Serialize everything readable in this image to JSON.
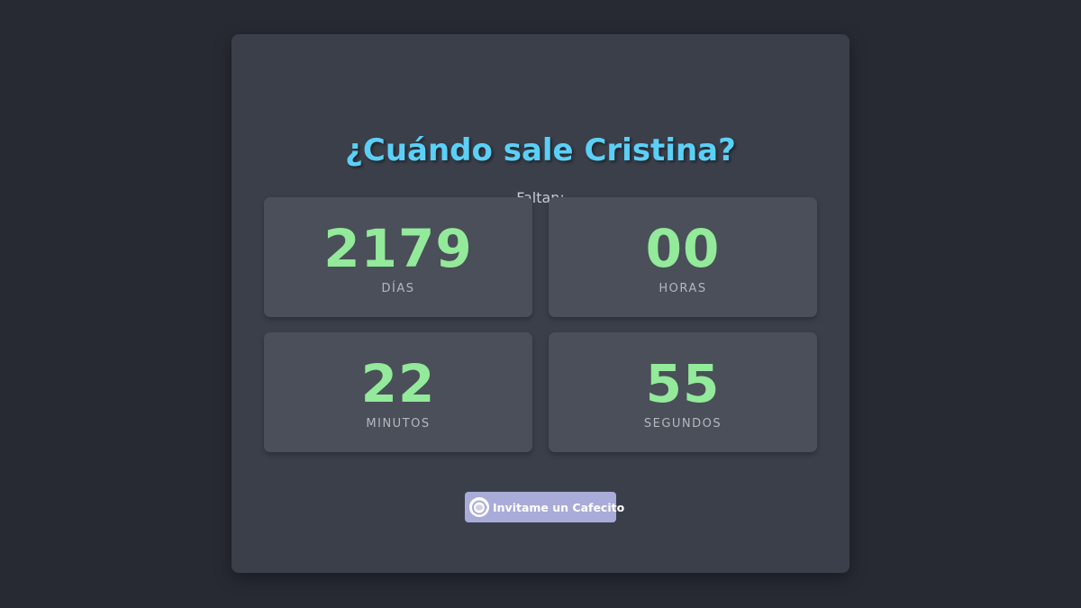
{
  "header": {
    "title": "¿Cuándo sale Cristina?",
    "subtitle": "Faltan:"
  },
  "countdown": [
    {
      "value": "2179",
      "label": "DÍAS"
    },
    {
      "value": "00",
      "label": "HORAS"
    },
    {
      "value": "22",
      "label": "MINUTOS"
    },
    {
      "value": "55",
      "label": "SEGUNDOS"
    }
  ],
  "donate": {
    "label": "Invitame un Cafecito",
    "icon": "coffee-cup-icon"
  },
  "colors": {
    "background": "#272a33",
    "card": "#3b3f4a",
    "box": "#4a4f59",
    "title": "#5bd0f7",
    "number": "#93ea9a",
    "button": "#a9abd8"
  }
}
